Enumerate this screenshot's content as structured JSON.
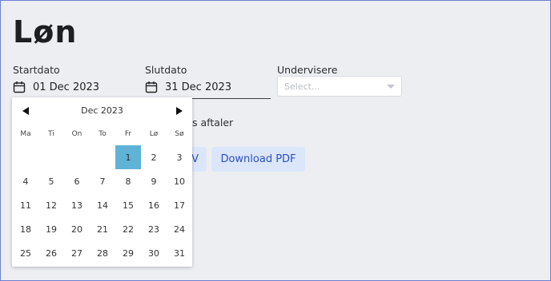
{
  "page": {
    "title": "Løn"
  },
  "filters": {
    "start": {
      "label": "Startdato",
      "value": "01 Dec 2023"
    },
    "end": {
      "label": "Slutdato",
      "value": "31 Dec 2023"
    },
    "teachers": {
      "label": "Undervisere",
      "placeholder": "Select..."
    }
  },
  "partial_checkbox_text": "s aftaler",
  "buttons": {
    "partial_label": "V",
    "pdf_label": "Download PDF"
  },
  "calendar": {
    "month_label": "Dec 2023",
    "weekdays": [
      "Ma",
      "Ti",
      "On",
      "To",
      "Fr",
      "Lø",
      "Sø"
    ],
    "leading_blanks": 4,
    "days": [
      "1",
      "2",
      "3",
      "4",
      "5",
      "6",
      "7",
      "8",
      "9",
      "10",
      "11",
      "12",
      "13",
      "14",
      "15",
      "16",
      "17",
      "18",
      "19",
      "20",
      "21",
      "22",
      "23",
      "24",
      "25",
      "26",
      "27",
      "28",
      "29",
      "30",
      "31"
    ],
    "selected_day": "1",
    "selected_color": "#5fb3d6"
  },
  "colors": {
    "background": "#eceef2",
    "button_bg": "#dce6fb",
    "button_text": "#2a4fbf"
  }
}
